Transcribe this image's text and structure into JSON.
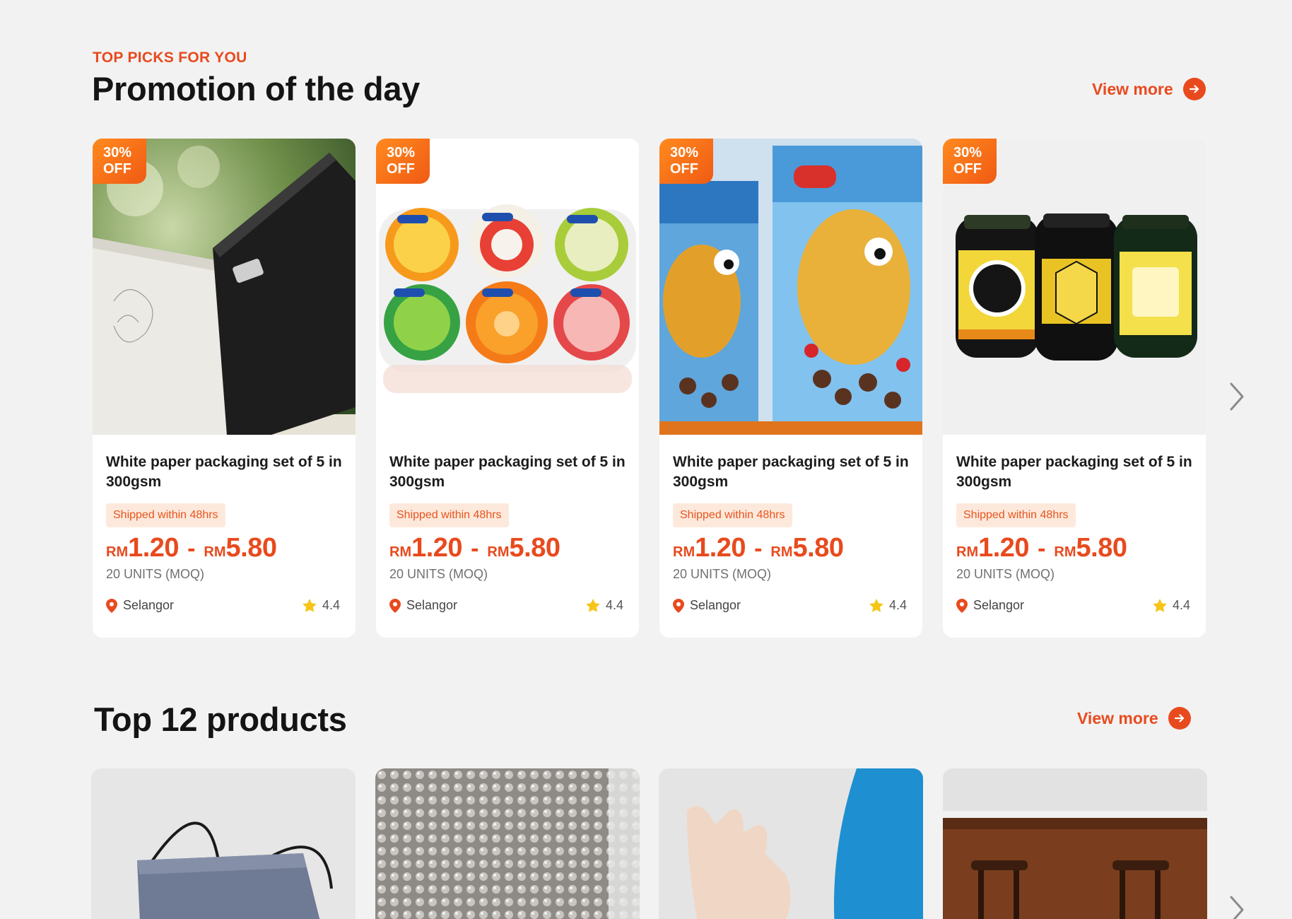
{
  "promo": {
    "eyebrow": "TOP PICKS FOR YOU",
    "title": "Promotion of the day",
    "view_more": "View more",
    "cards": [
      {
        "badge_line1": "30%",
        "badge_line2": "OFF",
        "title": "White paper packaging set of 5 in 300gsm",
        "shipping": "Shipped within 48hrs",
        "currency": "RM",
        "price_min": "1.20",
        "price_max": "5.80",
        "moq": "20 UNITS (MOQ)",
        "location": "Selangor",
        "rating": "4.4"
      },
      {
        "badge_line1": "30%",
        "badge_line2": "OFF",
        "title": "White paper packaging set of 5 in 300gsm",
        "shipping": "Shipped within 48hrs",
        "currency": "RM",
        "price_min": "1.20",
        "price_max": "5.80",
        "moq": "20 UNITS (MOQ)",
        "location": "Selangor",
        "rating": "4.4"
      },
      {
        "badge_line1": "30%",
        "badge_line2": "OFF",
        "title": "White paper packaging set of 5 in 300gsm",
        "shipping": "Shipped within 48hrs",
        "currency": "RM",
        "price_min": "1.20",
        "price_max": "5.80",
        "moq": "20 UNITS (MOQ)",
        "location": "Selangor",
        "rating": "4.4"
      },
      {
        "badge_line1": "30%",
        "badge_line2": "OFF",
        "title": "White paper packaging set of 5 in 300gsm",
        "shipping": "Shipped within 48hrs",
        "currency": "RM",
        "price_min": "1.20",
        "price_max": "5.80",
        "moq": "20 UNITS (MOQ)",
        "location": "Selangor",
        "rating": "4.4"
      }
    ]
  },
  "top": {
    "title": "Top 12 products",
    "view_more": "View more"
  },
  "colors": {
    "accent": "#e84a1e",
    "badge_start": "#ff8a1e",
    "badge_end": "#f05a14",
    "ship_tag_bg": "#fde9dc",
    "star": "#f5c518",
    "background": "#f2f2f2"
  },
  "icons": {
    "view_more": "arrow-right-circle-icon",
    "location": "location-pin-icon",
    "rating": "star-icon",
    "carousel": "chevron-right-icon"
  }
}
